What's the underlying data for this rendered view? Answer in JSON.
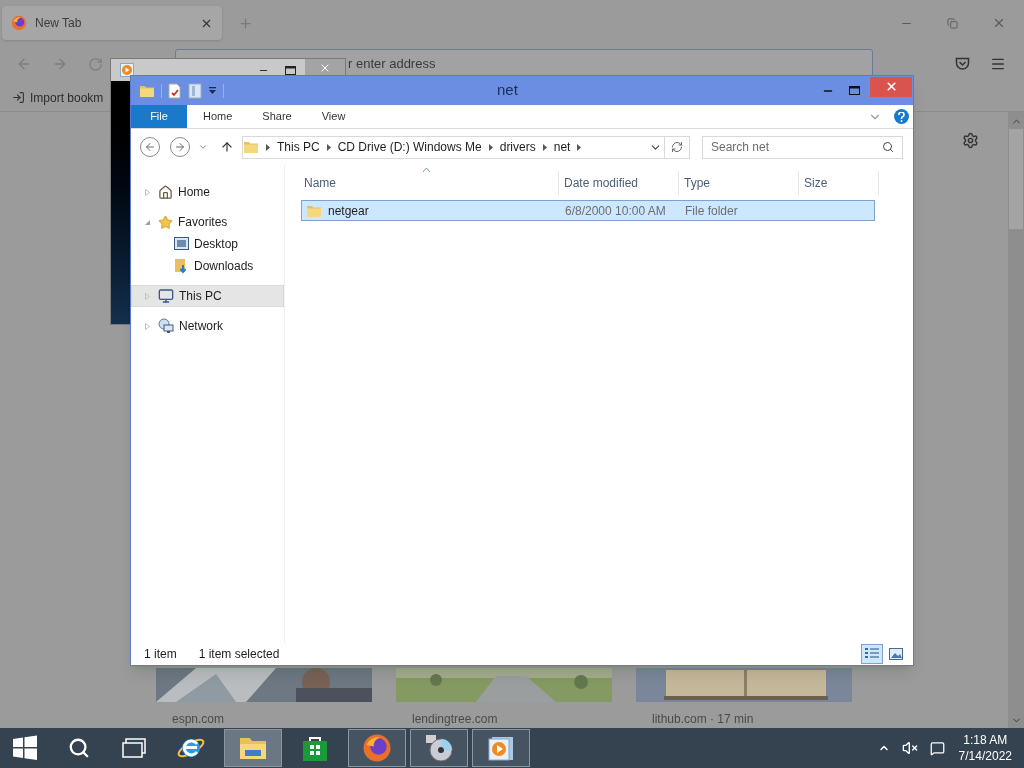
{
  "browser": {
    "tab": {
      "title": "New Tab"
    },
    "address": {
      "placeholder": "r enter address"
    },
    "bookmarks": [
      "Import bookm"
    ],
    "thumbnails": [
      {
        "kind": "picture",
        "label": "espn.com"
      },
      {
        "kind": "picture",
        "label": "lendingtree.com"
      },
      {
        "kind": "picture",
        "label": "lithub.com · 17 min"
      }
    ]
  },
  "explorer": {
    "title": "net",
    "ribbon_tabs": [
      {
        "label": "File",
        "kind": "file"
      },
      {
        "label": "Home",
        "kind": "tab"
      },
      {
        "label": "Share",
        "kind": "tab"
      },
      {
        "label": "View",
        "kind": "tab"
      }
    ],
    "breadcrumb": [
      "This PC",
      "CD Drive (D:) Windows Me",
      "drivers",
      "net"
    ],
    "search": {
      "placeholder": "Search net"
    },
    "nav": [
      {
        "label": "Home",
        "kind": "home",
        "expanded": false,
        "selected": false
      },
      {
        "label": "Favorites",
        "kind": "favorites",
        "expanded": true,
        "selected": false,
        "children": [
          {
            "label": "Desktop",
            "kind": "desktop",
            "selected": false
          },
          {
            "label": "Downloads",
            "kind": "downloads",
            "selected": false
          }
        ]
      },
      {
        "label": "This PC",
        "kind": "pc",
        "expanded": false,
        "selected": true
      },
      {
        "label": "Network",
        "kind": "network",
        "expanded": false,
        "selected": false
      }
    ],
    "columns": [
      "Name",
      "Date modified",
      "Type",
      "Size"
    ],
    "rows": [
      {
        "name": "netgear",
        "date": "6/8/2000 10:00 AM",
        "type": "File folder",
        "selected": true
      }
    ],
    "status": [
      "1 item",
      "1 item selected"
    ],
    "views": [
      {
        "kind": "details",
        "selected": true
      },
      {
        "kind": "tiles",
        "selected": false
      }
    ]
  },
  "taskbar": {
    "apps": [
      {
        "kind": "ie",
        "running": false,
        "selected": false
      },
      {
        "kind": "explorer",
        "running": true,
        "selected": true
      },
      {
        "kind": "store",
        "running": false,
        "selected": false
      },
      {
        "kind": "firefox",
        "running": true,
        "selected": false
      },
      {
        "kind": "cd",
        "running": true,
        "selected": false
      },
      {
        "kind": "player",
        "running": true,
        "selected": false
      }
    ],
    "volume": {
      "muted": true
    },
    "time": "1:18 AM",
    "date": "7/14/2022"
  }
}
